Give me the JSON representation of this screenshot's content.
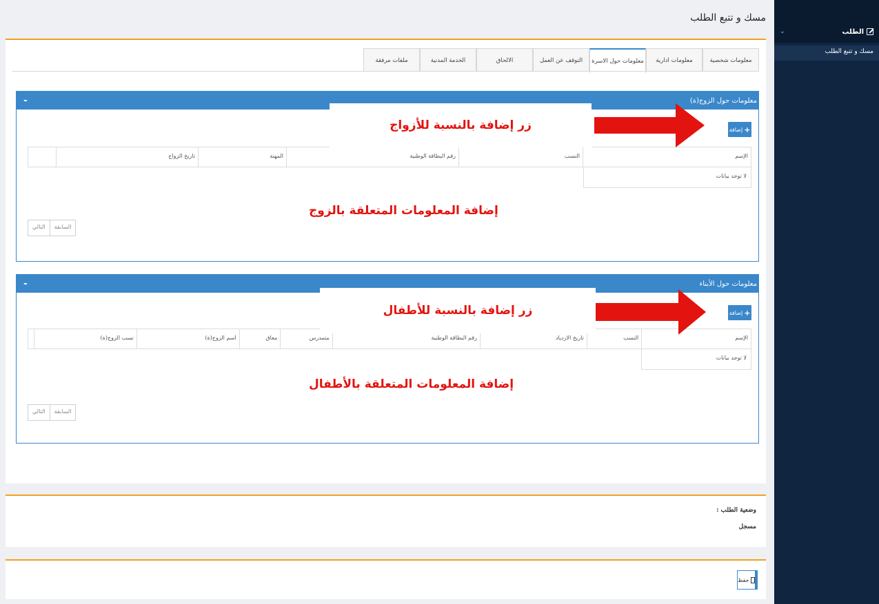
{
  "sidebar": {
    "menu_label": "الطلب",
    "sub_item": "مسك و تتبع الطلب"
  },
  "page_title": "مسك و تتبع الطلب",
  "tabs": [
    {
      "label": "معلومات شخصية"
    },
    {
      "label": "معلومات ادارية"
    },
    {
      "label": "معلومات حول الاسرة"
    },
    {
      "label": "التوقف عن العمل"
    },
    {
      "label": "الالحاق"
    },
    {
      "label": "الخدمة المدنية"
    },
    {
      "label": "ملفات مرفقة"
    }
  ],
  "active_tab": "معلومات حول الاسرة",
  "spouse_section": {
    "title": "معلومات حول الزوج(ة)",
    "collapse": "-",
    "add_label": "إضافة",
    "columns": [
      "الإسم",
      "النسب",
      "رقم البطاقة الوطنية",
      "المهنة",
      "تاريخ الزواج",
      ""
    ],
    "no_data": "لا توجد بيانات",
    "pager": {
      "prev": "السابقة",
      "next": "التالي"
    }
  },
  "children_section": {
    "title": "معلومات حول الأبناء",
    "collapse": "-",
    "add_label": "إضافة",
    "columns": [
      "الإسم",
      "النسب",
      "تاريخ الازدياد",
      "رقم البطاقة الوطنية",
      "متمدرس",
      "معاق",
      "اسم الزوج(ة)",
      "نسب الزوج(ة)",
      ""
    ],
    "no_data": "لا توجد بيانات",
    "pager": {
      "prev": "السابقة",
      "next": "التالي"
    }
  },
  "annotations": {
    "spouse_add": "زر إضافة بالنسبة للأزواج",
    "spouse_info": "إضافة المعلومات   المتعلقة بالزوج",
    "children_add": "زر إضافة بالنسبة للأطفال",
    "children_info": "إضافة المعلومات   المتعلقة بالأطفال"
  },
  "status": {
    "label": "وضعية الطلب :",
    "value": "مسجل"
  },
  "save_label": "حفظ",
  "colors": {
    "sidebar": "#0f2540",
    "accent": "#3a87c9",
    "orange_border": "#f0a020",
    "annotation_red": "#e3130f"
  }
}
